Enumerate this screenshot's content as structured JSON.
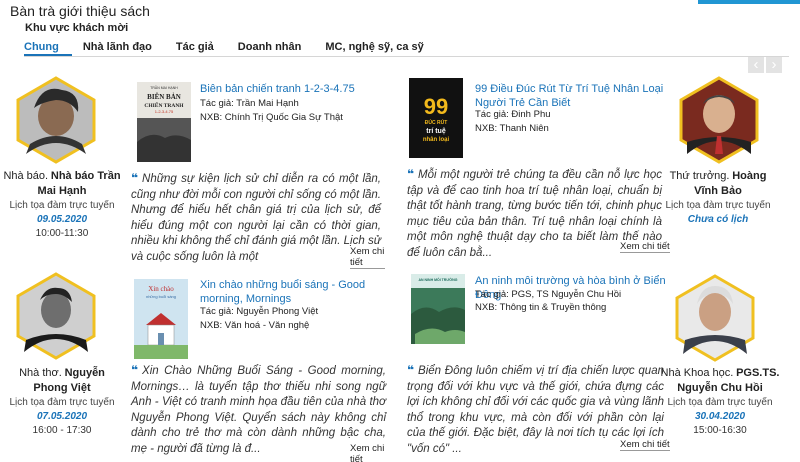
{
  "header": {
    "title": "Bàn trà giới thiệu sách",
    "subtitle": "Khu vực khách mời"
  },
  "tabs": [
    {
      "label": "Chung"
    },
    {
      "label": "Nhà lãnh đạo"
    },
    {
      "label": "Tác giả"
    },
    {
      "label": "Doanh nhân"
    },
    {
      "label": "MC, nghệ sỹ, ca sỹ"
    }
  ],
  "nav": {
    "prev": "‹",
    "next": "›"
  },
  "colors": {
    "accent": "#1a73b8",
    "hex_border": "#f0c020"
  },
  "cards": [
    {
      "person": {
        "role": "Nhà báo.",
        "name": "Nhà báo Trần Mai Hạnh",
        "status": "Lịch tọa đàm trực tuyến",
        "date": "09.05.2020",
        "time": "10:00-11:30"
      },
      "book": {
        "title": "Biên bản chiến tranh 1-2-3-4.75",
        "author": "Tác giả: Trần Mai Hạnh",
        "publisher": "NXB: Chính Trị Quốc Gia Sự Thật",
        "cover_author": "TRẦN MAI HẠNH",
        "cover_title_1": "BIÊN BẢN",
        "cover_title_2": "CHIẾN TRANH",
        "cover_sub": "1-2-3-4.75"
      },
      "quote": "Những sự kiện lịch sử chỉ diễn ra có một lần, cũng như đời mỗi con người chỉ sống có một lần. Nhưng để hiểu hết chân giá trị của lịch sử, để hiểu đúng một con người lại cần có thời gian, nhiều khi không thể chỉ đánh giá một lần. Lịch sử và cuộc sống luôn là một",
      "more": "Xem chi tiết"
    },
    {
      "person": {
        "role": "Thứ trưởng.",
        "name": "Hoàng Vĩnh Bảo",
        "status": "Lịch tọa đàm trực tuyến",
        "date": "Chưa có lịch",
        "time": ""
      },
      "book": {
        "title": "99 Điều Đúc Rút Từ Trí Tuệ Nhân Loại Người Trẻ Cần Biết",
        "author": "Tác giả: Đinh Phu",
        "publisher": "NXB: Thanh Niên",
        "cover_num": "99",
        "cover_title_1": "ĐÚC RÚT",
        "cover_title_2": "trí tuệ",
        "cover_title_3": "nhân loại"
      },
      "quote": "Mỗi một người trẻ chúng ta đều cần nỗ lực học tập và để cao tinh hoa trí tuệ nhân loại, chuẩn bị thật tốt hành trang, từng bước tiến tới, chinh phục mục tiêu của bản thân. Trí tuệ nhân loại chính là một môn nghệ thuật dạy cho ta biết làm thế nào để luôn cân bằ...",
      "more": "Xem chi tiết"
    },
    {
      "person": {
        "role": "Nhà thơ.",
        "name": "Nguyễn Phong Việt",
        "status": "Lịch tọa đàm trực tuyến",
        "date": "07.05.2020",
        "time": "16:00 - 17:30"
      },
      "book": {
        "title": "Xin chào những buổi sáng - Good morning, Mornings",
        "author": "Tác giả: Nguyễn Phong Việt",
        "publisher": "NXB: Văn hoá - Văn nghệ",
        "cover_title_1": "Xin chào",
        "cover_title_2": "những buổi sáng"
      },
      "quote": "Xin Chào Những Buổi Sáng - Good morning, Mornings… là tuyển tập thơ thiếu nhi song ngữ Anh - Việt có tranh minh họa đầu tiên của nhà thơ Nguyễn Phong Việt. Quyển sách này không chỉ dành cho trẻ thơ mà còn dành những bậc cha, mẹ - người đã từng là đ...",
      "more": "Xem chi tiết"
    },
    {
      "person": {
        "role": "Nhà Khoa học.",
        "name": "PGS.TS. Nguyễn Chu Hồi",
        "status": "Lịch tọa đàm trực tuyến",
        "date": "30.04.2020",
        "time": "15:00-16:30"
      },
      "book": {
        "title": "An ninh môi trường và hòa bình ở Biển Đông",
        "author": "Tác giả: PGS, TS Nguyễn Chu Hồi",
        "publisher": "NXB: Thông tin & Truyền thông",
        "cover_title_1": "AN NINH MÔI TRƯỜNG"
      },
      "quote": "Biển Đông luôn chiếm vị trí địa chiến lược quan trọng đối với khu vực và thế giới, chứa đựng các lợi ích không chỉ đối với các quốc gia và vùng lãnh thổ trong khu vực, mà còn đối với phần còn lại của thế giới. Đặc biệt, đây là nơi tích tụ các lợi ích \"vốn có\" ...",
      "more": "Xem chi tiết"
    }
  ]
}
